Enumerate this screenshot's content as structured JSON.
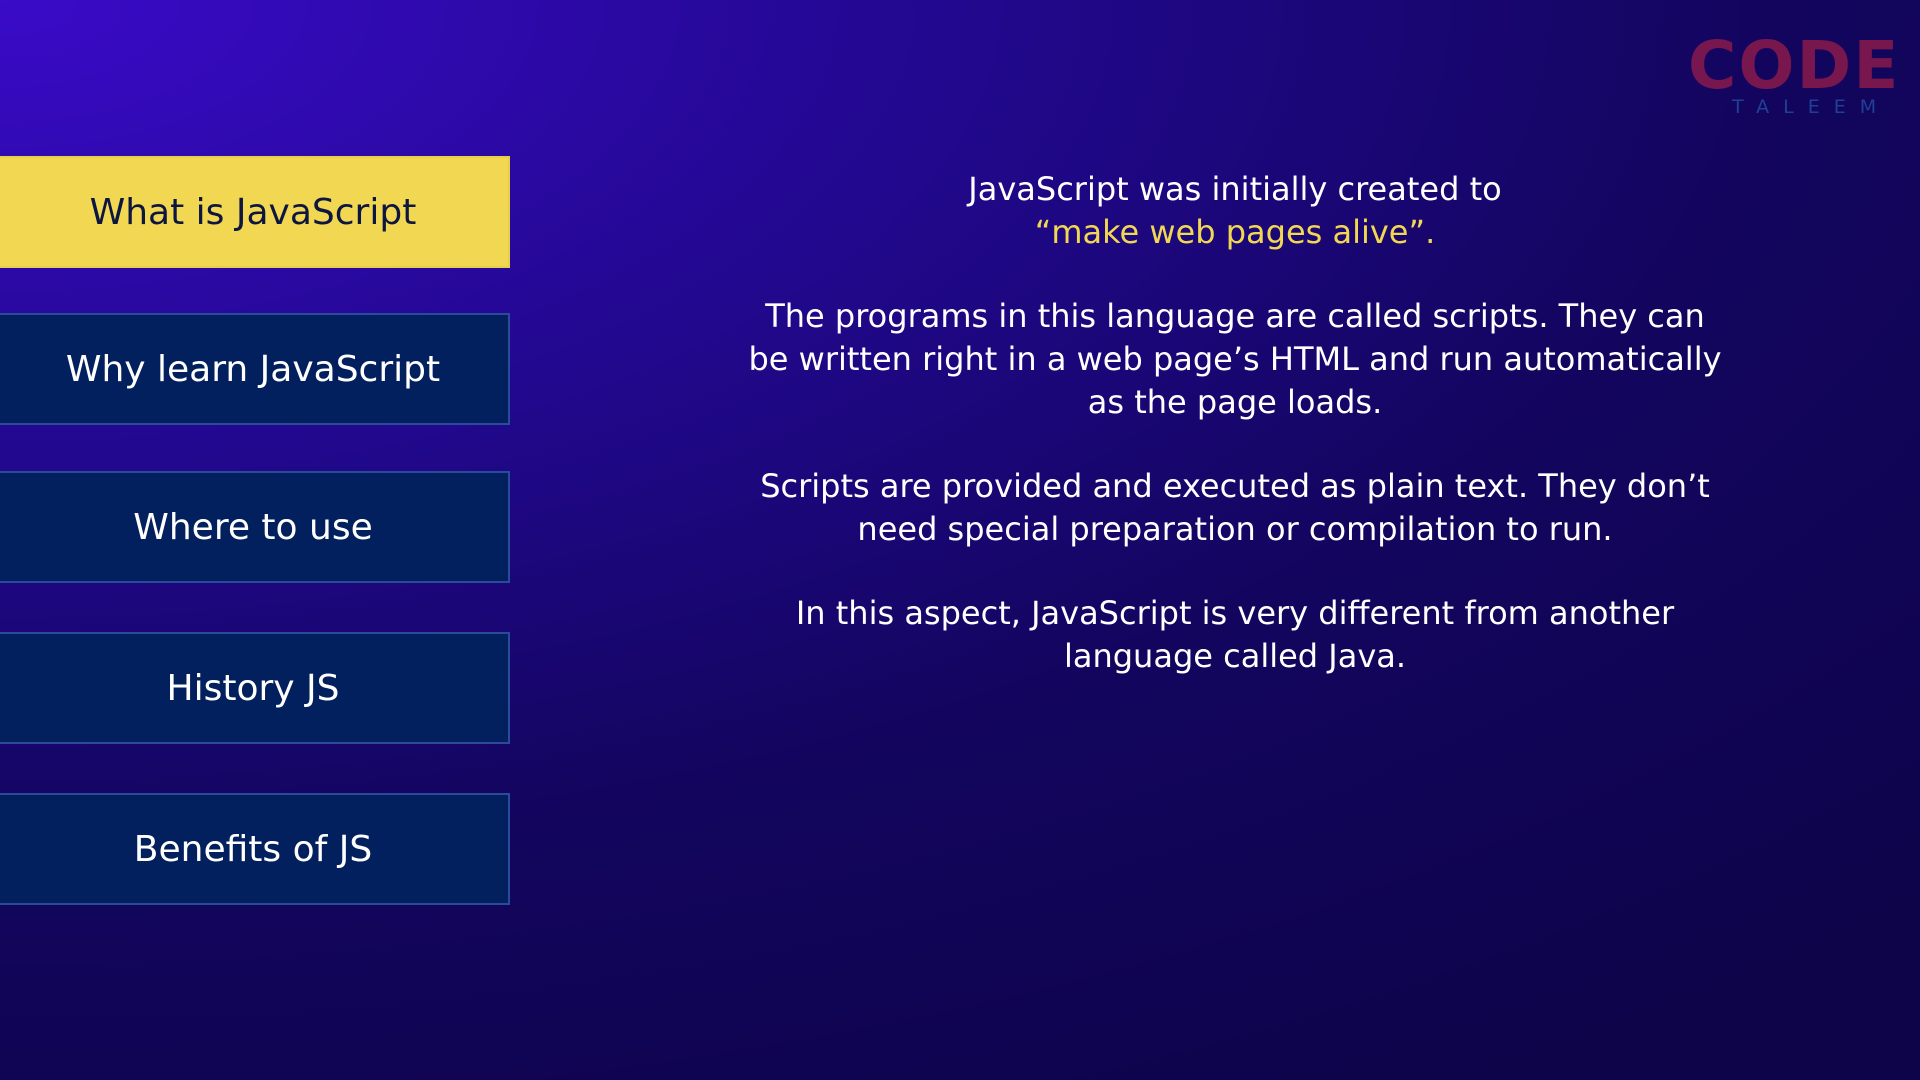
{
  "logo": {
    "code": "CODE",
    "taleem": "TALEEM"
  },
  "menu": {
    "items": [
      {
        "label": "What is JavaScript",
        "active": true
      },
      {
        "label": "Why learn JavaScript",
        "active": false
      },
      {
        "label": "Where to use",
        "active": false
      },
      {
        "label": "History JS",
        "active": false
      },
      {
        "label": "Benefits of JS",
        "active": false
      }
    ]
  },
  "content": {
    "para1_line1": "JavaScript was initially created to",
    "para1_highlight": "“make web pages alive”.",
    "para2_line1": "The programs in this language are called scripts. They can",
    "para2_line2": "be written right in a web page’s HTML and run automatically",
    "para2_line3": "as the page loads.",
    "para3_line1": "Scripts are provided and executed as plain text. They don’t",
    "para3_line2": "need special preparation or compilation to run.",
    "para4_line1": "In this aspect, JavaScript is very different from another",
    "para4_line2": "language called Java."
  },
  "colors": {
    "accent": "#f2d852",
    "button_bg": "#03205e",
    "logo_code": "#8a1a4c",
    "logo_taleem": "#203f97"
  }
}
